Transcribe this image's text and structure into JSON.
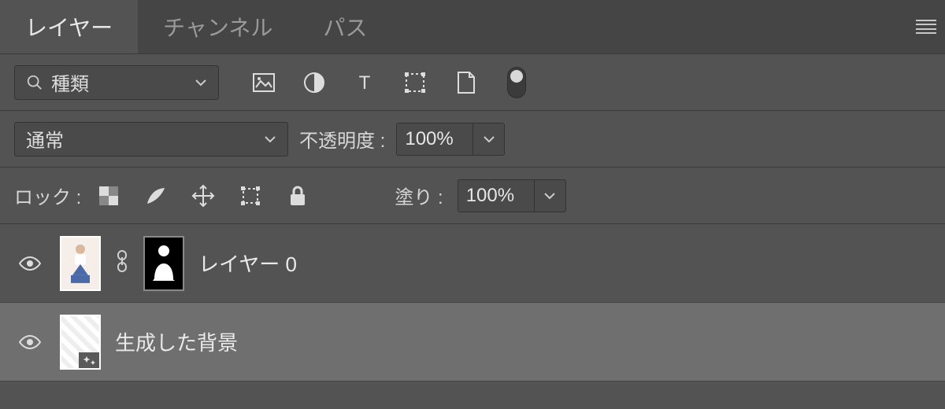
{
  "tabs": {
    "layers": "レイヤー",
    "channels": "チャンネル",
    "paths": "パス"
  },
  "filter": {
    "label": "種類"
  },
  "blend": {
    "mode": "通常",
    "opacity_label": "不透明度 :",
    "opacity_value": "100%"
  },
  "lock": {
    "label": "ロック :",
    "fill_label": "塗り :",
    "fill_value": "100%"
  },
  "layers_list": [
    {
      "name": "レイヤー 0"
    },
    {
      "name": "生成した背景"
    }
  ]
}
